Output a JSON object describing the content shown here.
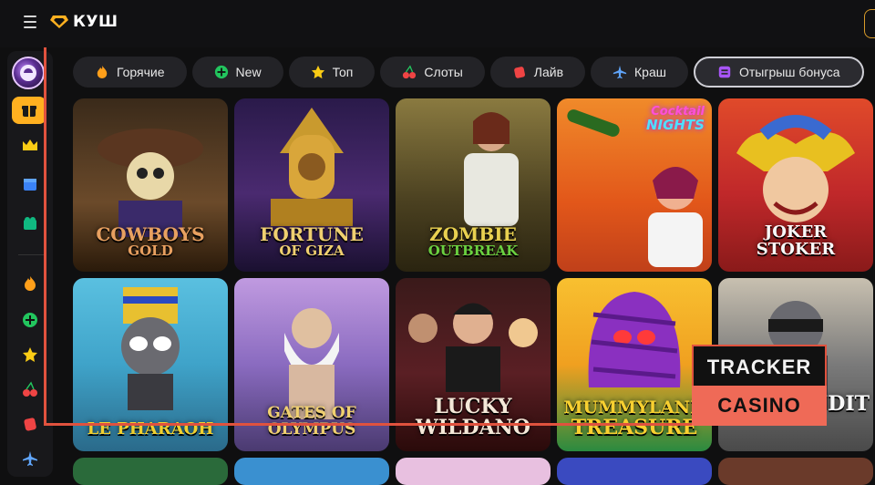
{
  "header": {
    "logo_text": "КУШ"
  },
  "categories": [
    {
      "label": "Горячие",
      "icon": "fire-icon",
      "color": "#ff9f1a"
    },
    {
      "label": "New",
      "icon": "plus-circle-icon",
      "color": "#22c55e"
    },
    {
      "label": "Топ",
      "icon": "star-icon",
      "color": "#facc15"
    },
    {
      "label": "Слоты",
      "icon": "cherry-icon",
      "color": "#ef4444"
    },
    {
      "label": "Лайв",
      "icon": "cards-icon",
      "color": "#ef4444"
    },
    {
      "label": "Краш",
      "icon": "plane-icon",
      "color": "#60a5fa"
    },
    {
      "label": "Отыгрыш бонуса",
      "icon": "bonus-icon",
      "color": "#a855f7",
      "active": true
    }
  ],
  "sidebar": {
    "items": [
      "avatar",
      "gift-icon",
      "crown-icon",
      "calendar-icon",
      "tournament-icon",
      "fire-icon",
      "plus-circle-icon",
      "star-icon",
      "cherry-icon",
      "cards-icon",
      "plane-icon"
    ]
  },
  "games": [
    {
      "title": "COWBOYS",
      "subtitle": "GOLD",
      "bg": "#6b4a2a"
    },
    {
      "title": "FORTUNE",
      "subtitle": "OF GIZA",
      "bg": "#4a2a70"
    },
    {
      "title": "ZOMBIE",
      "subtitle": "OUTBREAK",
      "bg": "#6a5a2a"
    },
    {
      "title": "Cocktail",
      "subtitle": "NIGHTS",
      "bg": "#e2571a"
    },
    {
      "title": "JOKER STOKER",
      "subtitle": "",
      "bg": "#c0282a"
    },
    {
      "title": "LE PHARAOH",
      "subtitle": "",
      "bg": "#3fa3c9"
    },
    {
      "title": "GATES OF OLYMPUS",
      "subtitle": "",
      "bg": "#8a6bc0"
    },
    {
      "title": "LUCKY",
      "subtitle": "WILDANO",
      "bg": "#5a1f24"
    },
    {
      "title": "MUMMYLAND",
      "subtitle": "TREASURE",
      "bg": "#f0a020"
    },
    {
      "title": "BANDIT",
      "subtitle": "",
      "bg": "#7a7a7a"
    }
  ],
  "watermark": {
    "line1": "TRACKER",
    "line2": "CASINO"
  }
}
